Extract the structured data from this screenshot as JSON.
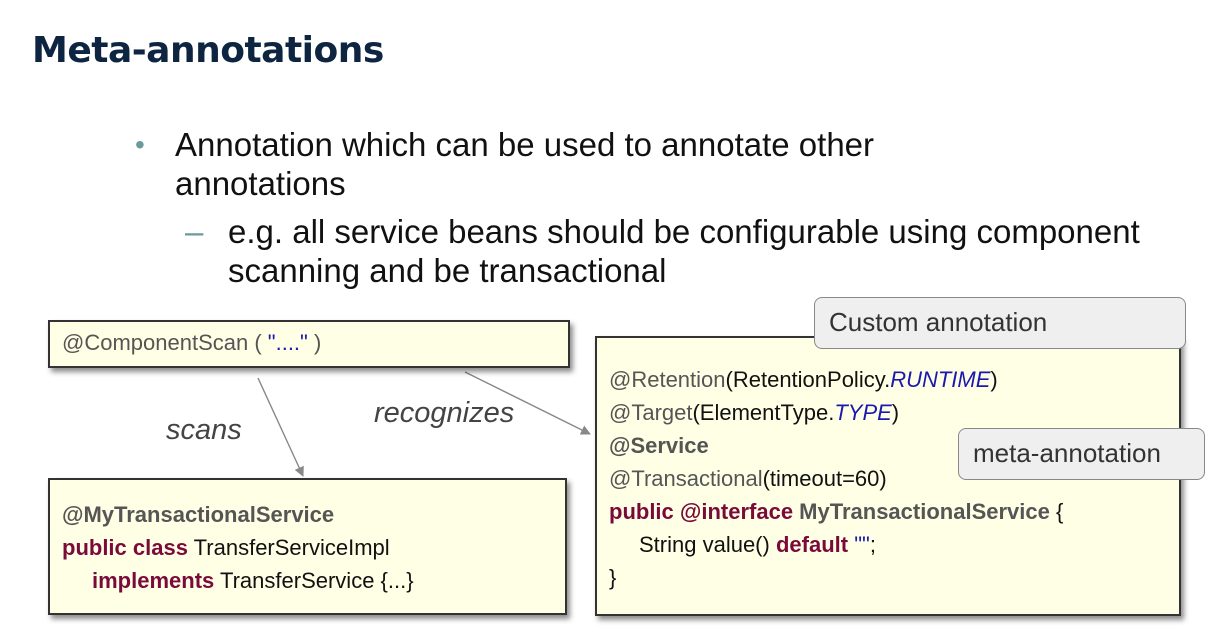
{
  "slide": {
    "title": "Meta-annotations",
    "bullet": "Annotation which can be used to annotate other annotations",
    "sub_bullet": "e.g. all service beans should be configurable using component scanning and be transactional",
    "bullet_symbol": "•",
    "dash_symbol": "–"
  },
  "component_scan_box": {
    "annotation": "@ComponentScan ( ",
    "value": "\"....\"",
    "close": " )"
  },
  "impl_box": {
    "line1": "@MyTransactionalService",
    "line2_kw": "public class",
    "line2_name": " TransferServiceImpl",
    "line3_kw": "implements",
    "line3_name": " TransferService {...}"
  },
  "code_box": {
    "retention_at": "@Retention",
    "retention_open": "(RetentionPolicy.",
    "retention_value": "RUNTIME",
    "retention_close": ")",
    "target_at": "@Target",
    "target_open": "(ElementType.",
    "target_value": "TYPE",
    "target_close": ")",
    "service": "@Service",
    "transactional_at": "@Transactional",
    "transactional_args": "(timeout=60)",
    "decl_public": "public",
    "decl_interface": " @interface",
    "decl_name": " MyTransactionalService",
    "decl_brace": " {",
    "member_type": "String value() ",
    "member_default": "default",
    "member_value": " \"\"",
    "member_end": ";",
    "close_brace": "}"
  },
  "callouts": {
    "custom": "Custom annotation",
    "meta": "meta-annotation"
  },
  "arrow_labels": {
    "scans": "scans",
    "recognizes": "recognizes"
  }
}
